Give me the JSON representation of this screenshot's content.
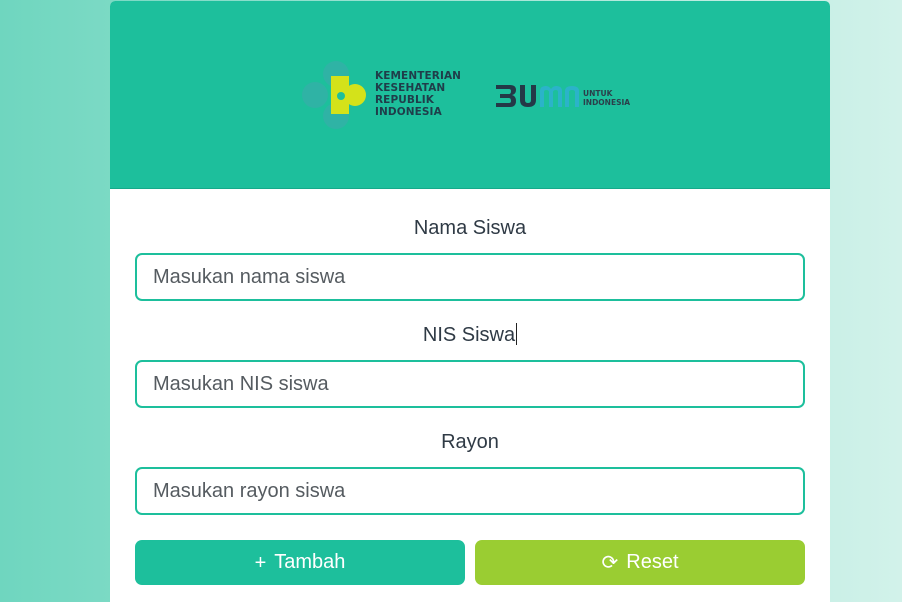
{
  "header": {
    "kemenkes_logo": {
      "icon": "kemenkes-logo",
      "lines": [
        "KEMENTERIAN",
        "KESEHATAN",
        "REPUBLIK",
        "INDONESIA"
      ]
    },
    "bumn_logo": {
      "icon": "bumn-logo",
      "sub_lines": [
        "UNTUK",
        "INDONESIA"
      ]
    }
  },
  "form": {
    "nama": {
      "label": "Nama Siswa",
      "placeholder": "Masukan nama siswa"
    },
    "nis": {
      "label": "NIS Siswa",
      "placeholder": "Masukan NIS siswa"
    },
    "rayon": {
      "label": "Rayon",
      "placeholder": "Masukan rayon siswa"
    }
  },
  "buttons": {
    "tambah": {
      "label": "Tambah",
      "icon": "plus-icon"
    },
    "reset": {
      "label": "Reset",
      "icon": "refresh-icon"
    }
  },
  "colors": {
    "primary": "#1dbf9c",
    "accent": "#9acd32",
    "background": "#a6e6d7"
  }
}
